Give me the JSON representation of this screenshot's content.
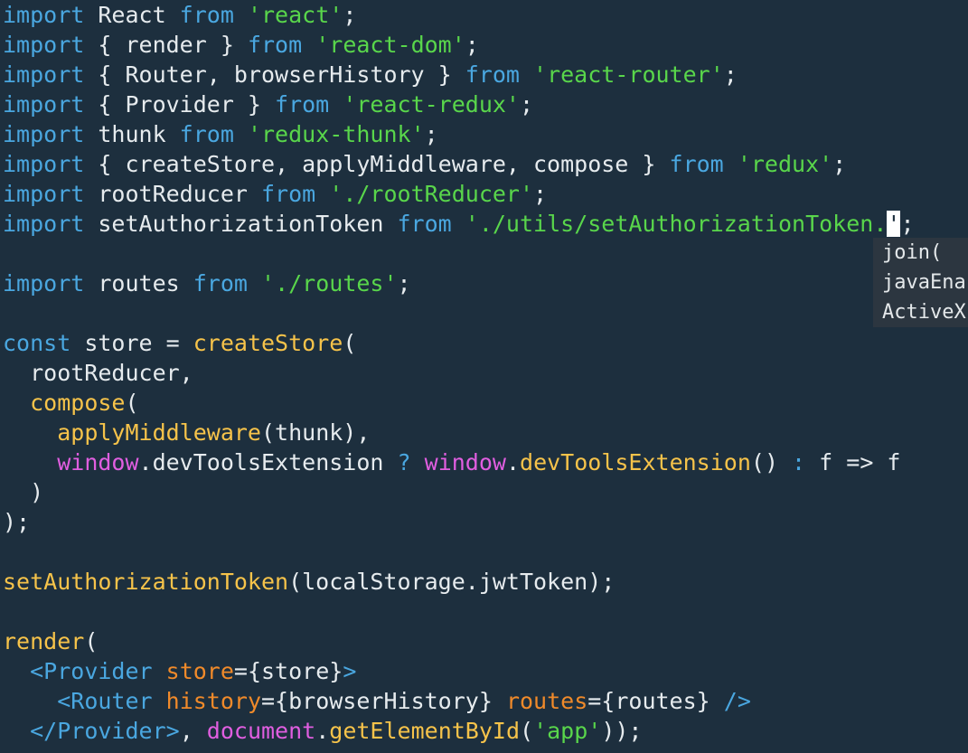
{
  "colors": {
    "background": "#1d2f3e",
    "plain": "#e6ebee",
    "keyword": "#4aa7e0",
    "string": "#59d64b",
    "function": "#f6c34a",
    "global": "#e05ee0",
    "attribute": "#f08a2a",
    "tag": "#4aa7e0",
    "operator": "#4aa7e0",
    "cursor": "#ffffff",
    "popup_bg": "#2c3640"
  },
  "code": {
    "lines": [
      [
        [
          "import",
          "keyword"
        ],
        [
          " React ",
          "plain"
        ],
        [
          "from",
          "keyword"
        ],
        [
          " ",
          "plain"
        ],
        [
          "'react'",
          "string"
        ],
        [
          ";",
          "plain"
        ]
      ],
      [
        [
          "import",
          "keyword"
        ],
        [
          " { render } ",
          "plain"
        ],
        [
          "from",
          "keyword"
        ],
        [
          " ",
          "plain"
        ],
        [
          "'react-dom'",
          "string"
        ],
        [
          ";",
          "plain"
        ]
      ],
      [
        [
          "import",
          "keyword"
        ],
        [
          " { Router, browserHistory } ",
          "plain"
        ],
        [
          "from",
          "keyword"
        ],
        [
          " ",
          "plain"
        ],
        [
          "'react-router'",
          "string"
        ],
        [
          ";",
          "plain"
        ]
      ],
      [
        [
          "import",
          "keyword"
        ],
        [
          " { Provider } ",
          "plain"
        ],
        [
          "from",
          "keyword"
        ],
        [
          " ",
          "plain"
        ],
        [
          "'react-redux'",
          "string"
        ],
        [
          ";",
          "plain"
        ]
      ],
      [
        [
          "import",
          "keyword"
        ],
        [
          " thunk ",
          "plain"
        ],
        [
          "from",
          "keyword"
        ],
        [
          " ",
          "plain"
        ],
        [
          "'redux-thunk'",
          "string"
        ],
        [
          ";",
          "plain"
        ]
      ],
      [
        [
          "import",
          "keyword"
        ],
        [
          " { createStore, applyMiddleware, compose } ",
          "plain"
        ],
        [
          "from",
          "keyword"
        ],
        [
          " ",
          "plain"
        ],
        [
          "'redux'",
          "string"
        ],
        [
          ";",
          "plain"
        ]
      ],
      [
        [
          "import",
          "keyword"
        ],
        [
          " rootReducer ",
          "plain"
        ],
        [
          "from",
          "keyword"
        ],
        [
          " ",
          "plain"
        ],
        [
          "'./rootReducer'",
          "string"
        ],
        [
          ";",
          "plain"
        ]
      ],
      [
        [
          "import",
          "keyword"
        ],
        [
          " setAuthorizationToken ",
          "plain"
        ],
        [
          "from",
          "keyword"
        ],
        [
          " ",
          "plain"
        ],
        [
          "'./utils/setAuthorizationToken.",
          "string"
        ],
        [
          "'",
          "cursor"
        ],
        [
          ";",
          "plain"
        ]
      ],
      [],
      [
        [
          "import",
          "keyword"
        ],
        [
          " routes ",
          "plain"
        ],
        [
          "from",
          "keyword"
        ],
        [
          " ",
          "plain"
        ],
        [
          "'./routes'",
          "string"
        ],
        [
          ";",
          "plain"
        ]
      ],
      [],
      [
        [
          "const",
          "keyword"
        ],
        [
          " store = ",
          "plain"
        ],
        [
          "createStore",
          "function"
        ],
        [
          "(",
          "plain"
        ]
      ],
      [
        [
          "  rootReducer,",
          "plain"
        ]
      ],
      [
        [
          "  ",
          "plain"
        ],
        [
          "compose",
          "function"
        ],
        [
          "(",
          "plain"
        ]
      ],
      [
        [
          "    ",
          "plain"
        ],
        [
          "applyMiddleware",
          "function"
        ],
        [
          "(thunk),",
          "plain"
        ]
      ],
      [
        [
          "    ",
          "plain"
        ],
        [
          "window",
          "global"
        ],
        [
          ".devToolsExtension ",
          "plain"
        ],
        [
          "?",
          "operator"
        ],
        [
          " ",
          "plain"
        ],
        [
          "window",
          "global"
        ],
        [
          ".",
          "plain"
        ],
        [
          "devToolsExtension",
          "function"
        ],
        [
          "() ",
          "plain"
        ],
        [
          ":",
          "operator"
        ],
        [
          " f ",
          "plain"
        ],
        [
          "=>",
          "plain"
        ],
        [
          " f",
          "plain"
        ]
      ],
      [
        [
          "  )",
          "plain"
        ]
      ],
      [
        [
          ");",
          "plain"
        ]
      ],
      [],
      [
        [
          "setAuthorizationToken",
          "function"
        ],
        [
          "(localStorage.jwtToken);",
          "plain"
        ]
      ],
      [],
      [
        [
          "render",
          "function"
        ],
        [
          "(",
          "plain"
        ]
      ],
      [
        [
          "  ",
          "plain"
        ],
        [
          "<Provider",
          "tag"
        ],
        [
          " ",
          "plain"
        ],
        [
          "store",
          "attribute"
        ],
        [
          "={store}",
          "plain"
        ],
        [
          ">",
          "tag"
        ]
      ],
      [
        [
          "    ",
          "plain"
        ],
        [
          "<Router",
          "tag"
        ],
        [
          " ",
          "plain"
        ],
        [
          "history",
          "attribute"
        ],
        [
          "={browserHistory} ",
          "plain"
        ],
        [
          "routes",
          "attribute"
        ],
        [
          "={routes} ",
          "plain"
        ],
        [
          "/>",
          "tag"
        ]
      ],
      [
        [
          "  ",
          "plain"
        ],
        [
          "</Provider>",
          "tag"
        ],
        [
          ", ",
          "plain"
        ],
        [
          "document",
          "global"
        ],
        [
          ".",
          "plain"
        ],
        [
          "getElementById",
          "function"
        ],
        [
          "(",
          "plain"
        ],
        [
          "'app'",
          "string"
        ],
        [
          "));",
          "plain"
        ]
      ]
    ]
  },
  "autocomplete": {
    "items": [
      "join(",
      "javaEna",
      "ActiveX"
    ]
  }
}
